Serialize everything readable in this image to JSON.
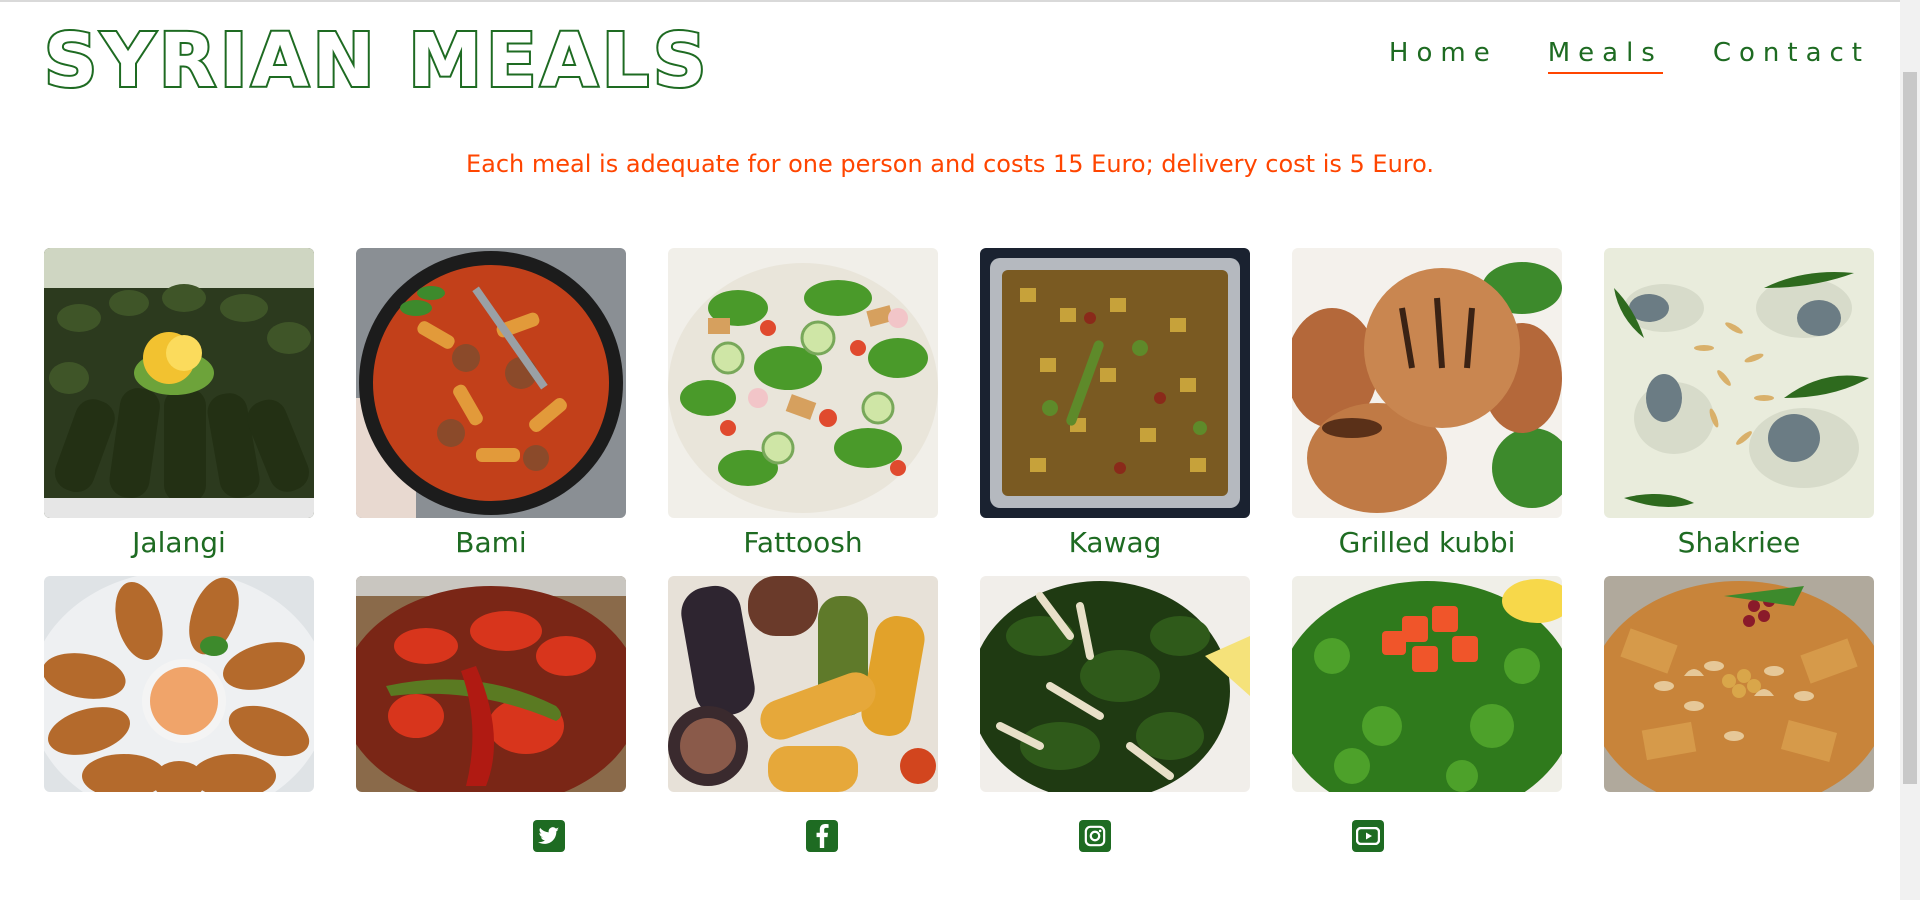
{
  "header": {
    "logo_text": "SYRIAN MEALS",
    "nav": [
      {
        "label": "Home",
        "active": false
      },
      {
        "label": "Meals",
        "active": true
      },
      {
        "label": "Contact",
        "active": false
      }
    ]
  },
  "notice": "Each meal is adequate for one person and costs 15 Euro; delivery cost is 5 Euro.",
  "meals_row1": [
    {
      "name": "Jalangi"
    },
    {
      "name": "Bami"
    },
    {
      "name": "Fattoosh"
    },
    {
      "name": "Kawag"
    },
    {
      "name": "Grilled kubbi"
    },
    {
      "name": "Shakriee"
    }
  ],
  "meals_row2": [
    {
      "name": ""
    },
    {
      "name": ""
    },
    {
      "name": ""
    },
    {
      "name": ""
    },
    {
      "name": ""
    },
    {
      "name": ""
    }
  ],
  "social_icons": [
    "twitter-icon",
    "facebook-icon",
    "instagram-icon",
    "youtube-icon"
  ],
  "colors": {
    "brand_green": "#1e6b22",
    "accent_orange": "#ff4500",
    "background": "#ffffff"
  }
}
